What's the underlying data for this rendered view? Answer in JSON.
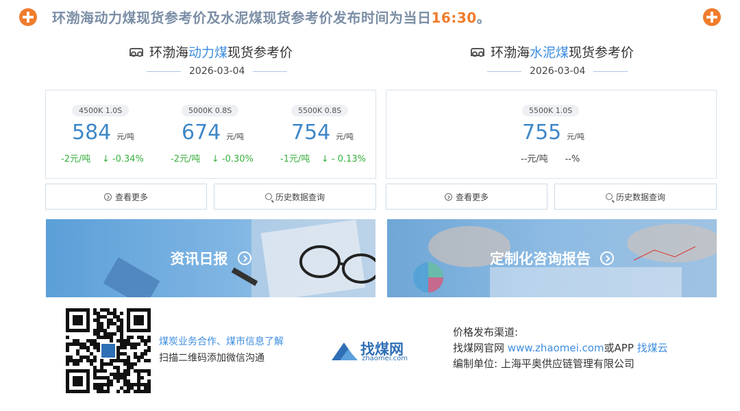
{
  "notice": {
    "text": "环渤海动力煤现货参考价及水泥煤现货参考价发布时间为当日",
    "time": "16:30",
    "end": "。"
  },
  "power_coal": {
    "title_prefix": "环渤海",
    "title_highlight": "动力煤",
    "title_suffix": "现货参考价",
    "date": "2026-03-04",
    "items": [
      {
        "tag": "4500K 1.0S",
        "price": "584",
        "unit": "元/吨",
        "change": "-2元/吨",
        "pct": "↓ -0.34%"
      },
      {
        "tag": "5000K 0.8S",
        "price": "674",
        "unit": "元/吨",
        "change": "-2元/吨",
        "pct": "↓ -0.30%"
      },
      {
        "tag": "5500K 0.8S",
        "price": "754",
        "unit": "元/吨",
        "change": "-1元/吨",
        "pct": "↓ - 0.13%"
      }
    ],
    "btn_more": "查看更多",
    "btn_history": "历史数据查询"
  },
  "cement_coal": {
    "title_prefix": "环渤海",
    "title_highlight": "水泥煤",
    "title_suffix": "现货参考价",
    "date": "2026-03-04",
    "item": {
      "tag": "5500K 1.0S",
      "price": "755",
      "unit": "元/吨",
      "change": "--元/吨",
      "pct": "--%"
    },
    "btn_more": "查看更多",
    "btn_history": "历史数据查询"
  },
  "banners": {
    "left": "资讯日报",
    "right": "定制化咨询报告"
  },
  "footer": {
    "qr_line1": "煤炭业务合作、煤市信息了解",
    "qr_line2": "扫描二维码添加微信沟通",
    "logo_cn": "找煤网",
    "logo_en": "zhaomei.com",
    "channel_title": "价格发布渠道:",
    "channel_prefix": "找煤网官网 ",
    "channel_url": "www.zhaomei.com",
    "channel_mid": "或APP ",
    "channel_app": "找煤云",
    "editor": "编制单位: 上海平奥供应链管理有限公司"
  },
  "colors": {
    "accent": "#f07c2c",
    "blue": "#3e87c8",
    "down": "#38b03c"
  }
}
